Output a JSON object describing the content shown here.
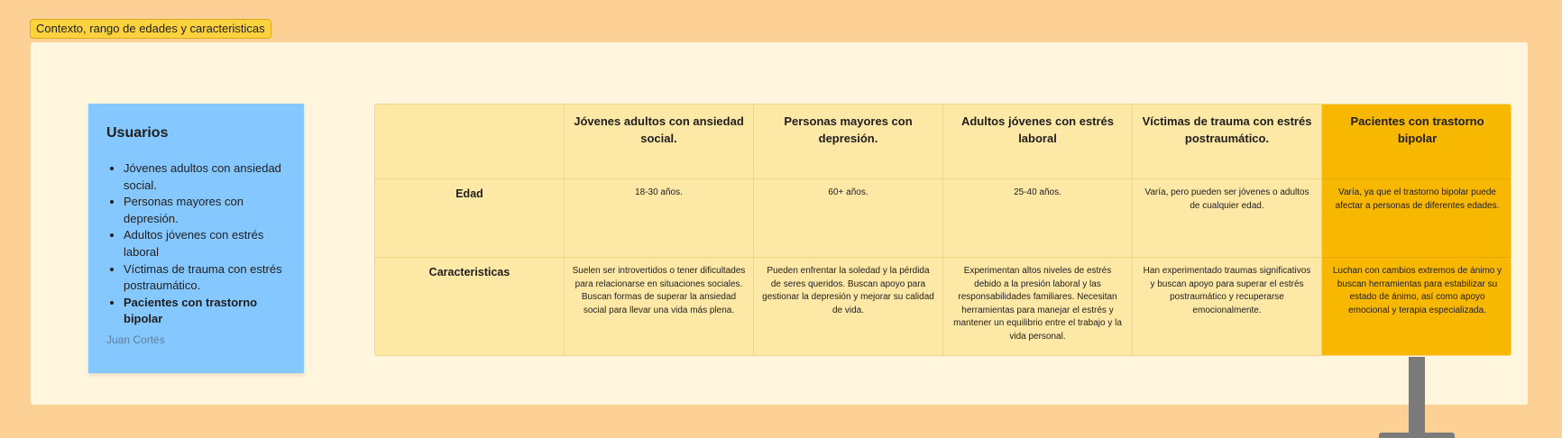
{
  "frame": {
    "title": "Contexto, rango de edades y caracteristicas"
  },
  "sticky": {
    "title": "Usuarios",
    "items": [
      {
        "label": "Jóvenes adultos con ansiedad social.",
        "bold": false
      },
      {
        "label": "Personas mayores con depresión.",
        "bold": false
      },
      {
        "label": "Adultos jóvenes con estrés laboral",
        "bold": false
      },
      {
        "label": "Víctimas de trauma con estrés postraumático.",
        "bold": false
      },
      {
        "label": "Pacientes con trastorno bipolar",
        "bold": true
      }
    ],
    "author": "Juan Cortés"
  },
  "table": {
    "columns": [
      "Jóvenes adultos con ansiedad social.",
      "Personas mayores con depresión.",
      "Adultos jóvenes con estrés laboral",
      "Víctimas de trauma con estrés postraumático.",
      "Pacientes con trastorno bipolar"
    ],
    "rows": [
      {
        "label": "Edad",
        "cells": [
          "18-30 años.",
          "60+ años.",
          "25-40 años.",
          "Varía, pero pueden ser jóvenes o adultos de cualquier edad.",
          "Varía, ya que el trastorno bipolar puede afectar a personas de diferentes edades."
        ]
      },
      {
        "label": "Caracteristicas",
        "cells": [
          "Suelen ser introvertidos o tener dificultades para relacionarse en situaciones sociales. Buscan formas de superar la ansiedad social para llevar una vida más plena.",
          "Pueden enfrentar la soledad y la pérdida de seres queridos. Buscan apoyo para gestionar la depresión y mejorar su calidad de vida.",
          "Experimentan altos niveles de estrés debido a la presión laboral y las responsabilidades familiares. Necesitan herramientas para manejar el estrés y mantener un equilibrio entre el trabajo y la vida personal.",
          "Han experimentado traumas significativos y buscan apoyo para superar el estrés postraumático y recuperarse emocionalmente.",
          "Luchan con cambios extremos de ánimo y buscan herramientas para estabilizar su estado de ánimo, así como apoyo emocional y terapia especializada."
        ]
      }
    ],
    "highlight_column_color": "#f8b700"
  },
  "colors": {
    "canvas": "#fdd096",
    "frame": "#fff6dd",
    "sticky": "#85c8ff",
    "table": "#fee8a6",
    "title_badge": "#fcd23f"
  }
}
